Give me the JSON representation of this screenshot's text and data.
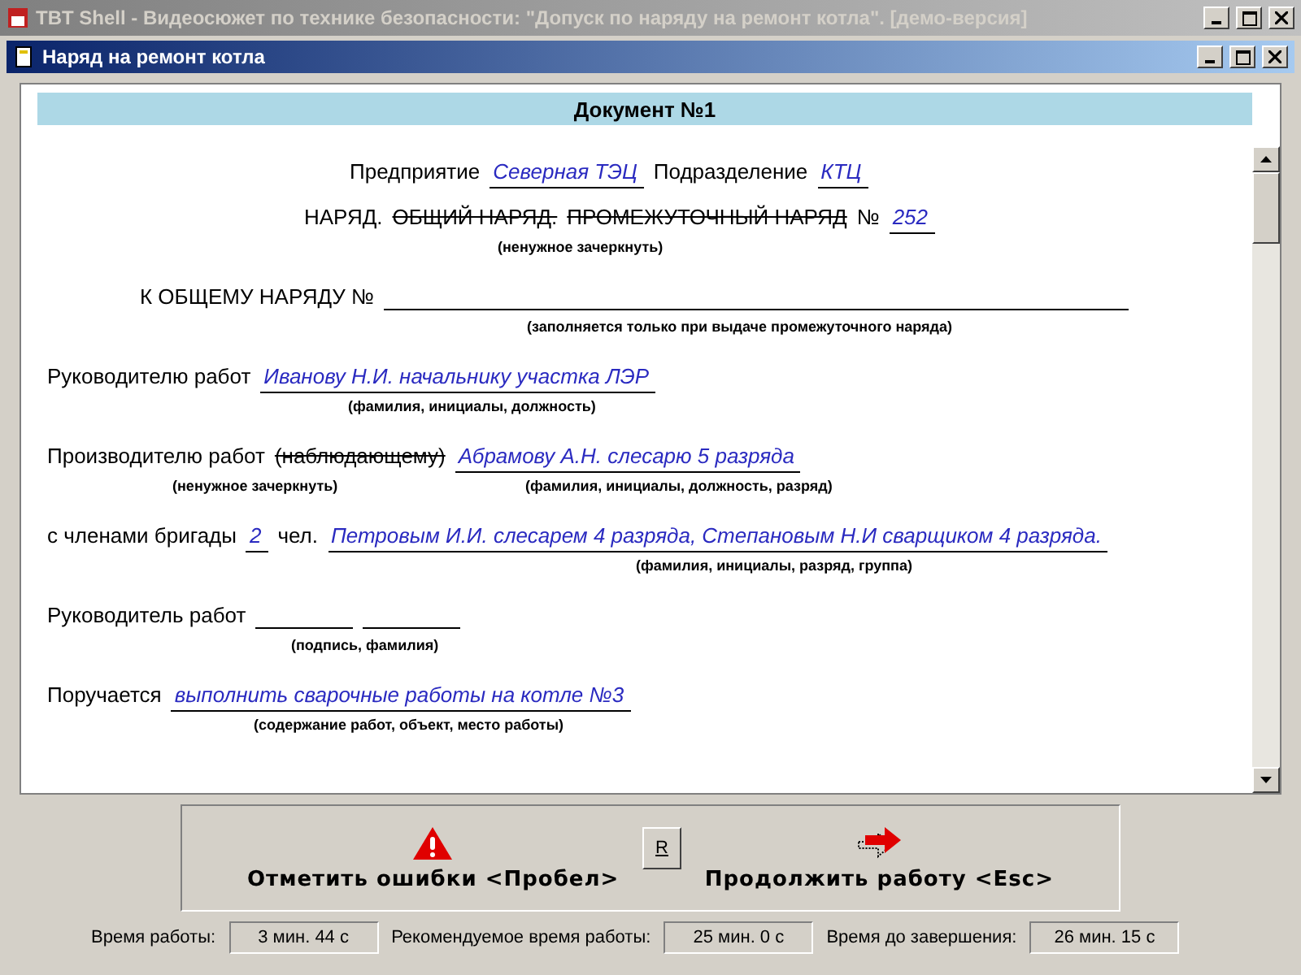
{
  "window": {
    "title": "TBT Shell - Видеосюжет по технике безопасности: \"Допуск по наряду на ремонт котла\". [демо-версия]"
  },
  "child_window": {
    "title": "Наряд на ремонт котла"
  },
  "document": {
    "title": "Документ №1",
    "lines": [
      {
        "kind": "row",
        "segments": [
          {
            "kind": "label",
            "text": "Предприятие"
          },
          {
            "kind": "value",
            "text": "Северная ТЭЦ"
          },
          {
            "kind": "label",
            "text": "Подразделение"
          },
          {
            "kind": "value",
            "text": "КТЦ"
          }
        ]
      },
      {
        "kind": "row",
        "segments": [
          {
            "kind": "label",
            "text": "НАРЯД."
          },
          {
            "kind": "struck",
            "text": "ОБЩИЙ НАРЯД."
          },
          {
            "kind": "struck",
            "text": "ПРОМЕЖУТОЧНЫЙ НАРЯД"
          },
          {
            "kind": "label",
            "text": "№"
          },
          {
            "kind": "value",
            "text": "252"
          }
        ]
      },
      {
        "kind": "hint",
        "texts": [
          "(ненужное зачеркнуть)"
        ]
      },
      {
        "kind": "row",
        "segments": [
          {
            "kind": "label",
            "text": "К ОБЩЕМУ НАРЯДУ №"
          },
          {
            "kind": "blank_long"
          }
        ]
      },
      {
        "kind": "hint",
        "texts": [
          "(заполняется только при выдаче промежуточного наряда)"
        ]
      },
      {
        "kind": "row",
        "segments": [
          {
            "kind": "label",
            "text": "Руководителю работ"
          },
          {
            "kind": "value",
            "text": "Иванову Н.И. начальнику участка ЛЭР"
          }
        ]
      },
      {
        "kind": "hint",
        "texts": [
          "(фамилия, инициалы, должность)"
        ]
      },
      {
        "kind": "row",
        "segments": [
          {
            "kind": "label",
            "text": "Производителю работ"
          },
          {
            "kind": "struck",
            "text": "(наблюдающему)"
          },
          {
            "kind": "value",
            "text": "Абрамову А.Н. слесарю 5 разряда"
          }
        ]
      },
      {
        "kind": "hint",
        "texts": [
          "(ненужное зачеркнуть)",
          "(фамилия, инициалы, должность, разряд)"
        ]
      },
      {
        "kind": "row",
        "segments": [
          {
            "kind": "label",
            "text": "с членами бригады"
          },
          {
            "kind": "value",
            "text": "2"
          },
          {
            "kind": "label",
            "text": "чел."
          },
          {
            "kind": "value",
            "text": "Петровым И.И. слесарем 4 разряда, Степановым Н.И сварщиком 4 разряда."
          }
        ]
      },
      {
        "kind": "hint",
        "texts": [
          "(фамилия, инициалы, разряд, группа)"
        ]
      },
      {
        "kind": "row",
        "segments": [
          {
            "kind": "label",
            "text": "Руководитель работ"
          },
          {
            "kind": "blank"
          },
          {
            "kind": "blank"
          }
        ]
      },
      {
        "kind": "hint",
        "texts": [
          "(подпись, фамилия)"
        ]
      },
      {
        "kind": "row",
        "segments": [
          {
            "kind": "label",
            "text": "Поручается"
          },
          {
            "kind": "value",
            "text": "выполнить сварочные работы на котле №3"
          }
        ]
      },
      {
        "kind": "hint",
        "texts": [
          "(содержание работ, объект, место работы)"
        ]
      }
    ]
  },
  "actions": {
    "mark_errors": "Отметить ошибки <Пробел>",
    "small_button": "R",
    "continue": "Продолжить работу <Esc>"
  },
  "status_bar": [
    {
      "label": "Время работы:",
      "value": "3 мин. 44 с"
    },
    {
      "label": "Рекомендуемое время работы:",
      "value": "25 мин. 0 с"
    },
    {
      "label": "Время до завершения:",
      "value": "26 мин. 15 с"
    }
  ]
}
